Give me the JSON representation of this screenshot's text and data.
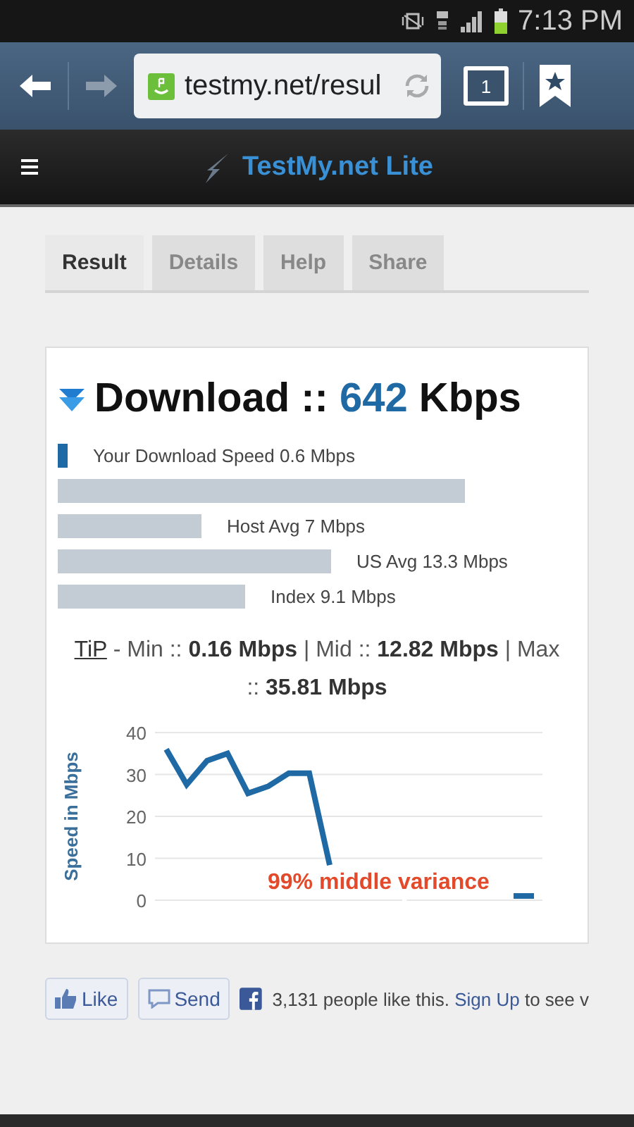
{
  "status_bar": {
    "time": "7:13 PM"
  },
  "browser": {
    "url": "testmy.net/resul",
    "tab_count": "1"
  },
  "app_header": {
    "title": "TestMy.net Lite"
  },
  "tabs": [
    {
      "label": "Result",
      "selected": true
    },
    {
      "label": "Details",
      "selected": false
    },
    {
      "label": "Help",
      "selected": false
    },
    {
      "label": "Share",
      "selected": false
    }
  ],
  "result": {
    "heading": "Download ::",
    "value": "642",
    "unit": "Kbps",
    "bars": [
      {
        "label": "Your Download Speed 0.6 Mbps",
        "kind": "yours"
      },
      {
        "kind": "other"
      },
      {
        "label": "Host Avg 7 Mbps",
        "kind": "other"
      },
      {
        "label": "US Avg 13.3 Mbps",
        "kind": "other"
      },
      {
        "label": "Index 9.1 Mbps",
        "kind": "other"
      }
    ],
    "tip": {
      "link": "TiP",
      "text": " - Min :: **0.16 Mbps** | Mid :: **12.82 Mbps** | Max :: **35.81 Mbps**"
    },
    "chart_data": {
      "type": "line",
      "ylabel": "Speed in Mbps",
      "ylim": [
        0,
        40
      ],
      "yticks": [
        0,
        10,
        20,
        30,
        40
      ],
      "grid": true,
      "series": [
        {
          "color": "#1f6aa5",
          "values": [
            36,
            27.6,
            33.3,
            35,
            25.5,
            27.2,
            30.3,
            30.3,
            8.4,
            null,
            null,
            null,
            null,
            null,
            null,
            null,
            null,
            1,
            1
          ]
        }
      ],
      "annotations": [
        "99% middle variance"
      ]
    }
  },
  "social": {
    "like": "Like",
    "send": "Send",
    "text": "3,131 people like this.",
    "link": "Sign Up",
    "tail": "to see v"
  }
}
